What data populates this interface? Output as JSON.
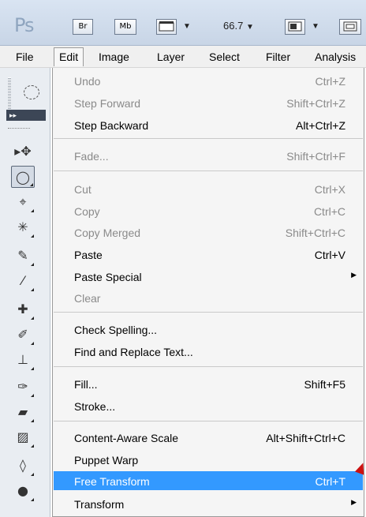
{
  "appbar": {
    "logo": "Ps",
    "bridge_label": "Br",
    "minibridge_label": "Mb",
    "zoom": "66.7"
  },
  "menubar": [
    "File",
    "Edit",
    "Image",
    "Layer",
    "Select",
    "Filter",
    "Analysis"
  ],
  "menu": {
    "items": [
      {
        "label": "Undo",
        "shortcut": "Ctrl+Z",
        "disabled": true
      },
      {
        "label": "Step Forward",
        "shortcut": "Shift+Ctrl+Z",
        "disabled": true
      },
      {
        "label": "Step Backward",
        "shortcut": "Alt+Ctrl+Z",
        "disabled": false
      },
      {
        "label": "Fade...",
        "shortcut": "Shift+Ctrl+F",
        "disabled": true
      },
      {
        "label": "Cut",
        "shortcut": "Ctrl+X",
        "disabled": true
      },
      {
        "label": "Copy",
        "shortcut": "Ctrl+C",
        "disabled": true
      },
      {
        "label": "Copy Merged",
        "shortcut": "Shift+Ctrl+C",
        "disabled": true
      },
      {
        "label": "Paste",
        "shortcut": "Ctrl+V",
        "disabled": false
      },
      {
        "label": "Paste Special",
        "shortcut": "",
        "disabled": false,
        "submenu": true
      },
      {
        "label": "Clear",
        "shortcut": "",
        "disabled": true
      },
      {
        "label": "Check Spelling...",
        "shortcut": "",
        "disabled": false
      },
      {
        "label": "Find and Replace Text...",
        "shortcut": "",
        "disabled": false
      },
      {
        "label": "Fill...",
        "shortcut": "Shift+F5",
        "disabled": false
      },
      {
        "label": "Stroke...",
        "shortcut": "",
        "disabled": false
      },
      {
        "label": "Content-Aware Scale",
        "shortcut": "Alt+Shift+Ctrl+C",
        "disabled": false
      },
      {
        "label": "Puppet Warp",
        "shortcut": "",
        "disabled": false
      },
      {
        "label": "Free Transform",
        "shortcut": "Ctrl+T",
        "disabled": false,
        "highlighted": true
      },
      {
        "label": "Transform",
        "shortcut": "",
        "disabled": false,
        "submenu": true
      }
    ]
  },
  "colors": {
    "highlight": "#3399ff",
    "disabled_text": "#8a8a8a",
    "annotation_arrow": "#cc1111"
  }
}
